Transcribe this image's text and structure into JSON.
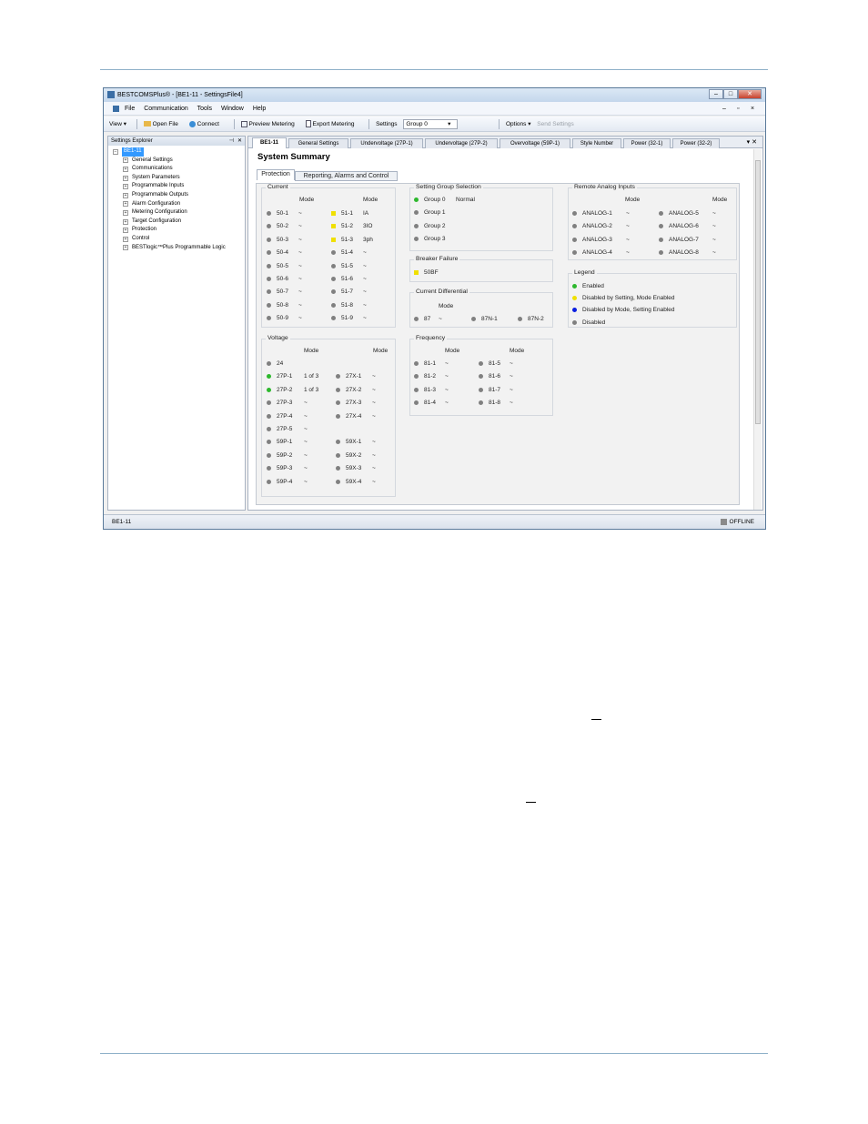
{
  "window": {
    "title": "BESTCOMSPlus® - [BE1-11 - SettingsFile4]",
    "controls": {
      "minimize": "–",
      "maximize": "□",
      "close": "✕"
    }
  },
  "menu": {
    "items": [
      "File",
      "Communication",
      "Tools",
      "Window",
      "Help"
    ],
    "right": [
      "–",
      "▫",
      "×"
    ]
  },
  "toolbar": {
    "view": "View ▾",
    "open_file": "Open File",
    "connect": "Connect",
    "preview_metering": "Preview Metering",
    "export_metering": "Export Metering",
    "settings_label": "Settings",
    "group_value": "Group 0",
    "options": "Options ▾",
    "send_settings": "Send Settings"
  },
  "explorer": {
    "title": "Settings Explorer",
    "pin": "⊣",
    "close": "✕",
    "root": "BE1-11",
    "items": [
      "General Settings",
      "Communications",
      "System Parameters",
      "Programmable Inputs",
      "Programmable Outputs",
      "Alarm Configuration",
      "Metering Configuration",
      "Target Configuration",
      "Protection",
      "Control",
      "BESTlogic™Plus Programmable Logic"
    ]
  },
  "doc_tabs": [
    "BE1-11",
    "General Settings",
    "Undervoltage (27P-1)",
    "Undervoltage (27P-2)",
    "Overvoltage (59P-1)",
    "Style Number",
    "Power (32-1)",
    "Power (32-2)"
  ],
  "doc_tab_controls": "▾ ✕",
  "summary": {
    "title": "System Summary",
    "subtabs": [
      "Protection",
      "Reporting, Alarms and Control"
    ],
    "mode_header": "Mode",
    "current": {
      "title": "Current",
      "left": [
        {
          "name": "50-1",
          "mode": "~"
        },
        {
          "name": "50-2",
          "mode": "~"
        },
        {
          "name": "50-3",
          "mode": "~"
        },
        {
          "name": "50-4",
          "mode": "~"
        },
        {
          "name": "50-5",
          "mode": "~"
        },
        {
          "name": "50-6",
          "mode": "~"
        },
        {
          "name": "50-7",
          "mode": "~"
        },
        {
          "name": "50-8",
          "mode": "~"
        },
        {
          "name": "50-9",
          "mode": "~"
        }
      ],
      "right": [
        {
          "name": "51-1",
          "mode": "IA",
          "status": "yellow"
        },
        {
          "name": "51-2",
          "mode": "3IO",
          "status": "yellow"
        },
        {
          "name": "51-3",
          "mode": "3ph",
          "status": "yellow"
        },
        {
          "name": "51-4",
          "mode": "~"
        },
        {
          "name": "51-5",
          "mode": "~"
        },
        {
          "name": "51-6",
          "mode": "~"
        },
        {
          "name": "51-7",
          "mode": "~"
        },
        {
          "name": "51-8",
          "mode": "~"
        },
        {
          "name": "51-9",
          "mode": "~"
        }
      ]
    },
    "voltage": {
      "title": "Voltage",
      "left": [
        {
          "name": "24",
          "mode": ""
        },
        {
          "name": "27P-1",
          "mode": "1 of 3",
          "status": "green"
        },
        {
          "name": "27P-2",
          "mode": "1 of 3",
          "status": "green"
        },
        {
          "name": "27P-3",
          "mode": "~"
        },
        {
          "name": "27P-4",
          "mode": "~"
        },
        {
          "name": "27P-5",
          "mode": "~"
        },
        {
          "name": "59P-1",
          "mode": "~"
        },
        {
          "name": "59P-2",
          "mode": "~"
        },
        {
          "name": "59P-3",
          "mode": "~"
        },
        {
          "name": "59P-4",
          "mode": "~"
        }
      ],
      "right": [
        {
          "name": "27X-1",
          "mode": "~"
        },
        {
          "name": "27X-2",
          "mode": "~"
        },
        {
          "name": "27X-3",
          "mode": "~"
        },
        {
          "name": "27X-4",
          "mode": "~"
        },
        {
          "name": "59X-1",
          "mode": "~"
        },
        {
          "name": "59X-2",
          "mode": "~"
        },
        {
          "name": "59X-3",
          "mode": "~"
        },
        {
          "name": "59X-4",
          "mode": "~"
        }
      ]
    },
    "setting_group": {
      "title": "Setting Group Selection",
      "items": [
        {
          "name": "Group 0",
          "mode": "Normal",
          "status": "green"
        },
        {
          "name": "Group 1"
        },
        {
          "name": "Group 2"
        },
        {
          "name": "Group 3"
        }
      ]
    },
    "breaker_failure": {
      "title": "Breaker Failure",
      "item": "50BF"
    },
    "current_differential": {
      "title": "Current Differential",
      "mode_header": "Mode",
      "items": [
        {
          "name": "87",
          "mode": "~"
        },
        {
          "name": "87N-1"
        },
        {
          "name": "87N-2"
        }
      ]
    },
    "frequency": {
      "title": "Frequency",
      "left": [
        {
          "name": "81-1",
          "mode": "~"
        },
        {
          "name": "81-2",
          "mode": "~"
        },
        {
          "name": "81-3",
          "mode": "~"
        },
        {
          "name": "81-4",
          "mode": "~"
        }
      ],
      "right": [
        {
          "name": "81-5",
          "mode": "~"
        },
        {
          "name": "81-6",
          "mode": "~"
        },
        {
          "name": "81-7",
          "mode": "~"
        },
        {
          "name": "81-8",
          "mode": "~"
        }
      ]
    },
    "remote_analog": {
      "title": "Remote Analog Inputs",
      "left": [
        {
          "name": "ANALOG-1",
          "mode": "~"
        },
        {
          "name": "ANALOG-2",
          "mode": "~"
        },
        {
          "name": "ANALOG-3",
          "mode": "~"
        },
        {
          "name": "ANALOG-4",
          "mode": "~"
        }
      ],
      "right": [
        {
          "name": "ANALOG-5",
          "mode": "~"
        },
        {
          "name": "ANALOG-6",
          "mode": "~"
        },
        {
          "name": "ANALOG-7",
          "mode": "~"
        },
        {
          "name": "ANALOG-8",
          "mode": "~"
        }
      ]
    },
    "legend": {
      "title": "Legend",
      "items": [
        {
          "label": "Enabled",
          "color": "#2db82d"
        },
        {
          "label": "Disabled by Setting, Mode Enabled",
          "color": "#f0e000"
        },
        {
          "label": "Disabled by Mode, Setting Enabled",
          "color": "#0a1ee0"
        },
        {
          "label": "Disabled",
          "color": "#808080"
        }
      ]
    }
  },
  "status": {
    "left": "BE1-11",
    "right": "OFFLINE"
  }
}
